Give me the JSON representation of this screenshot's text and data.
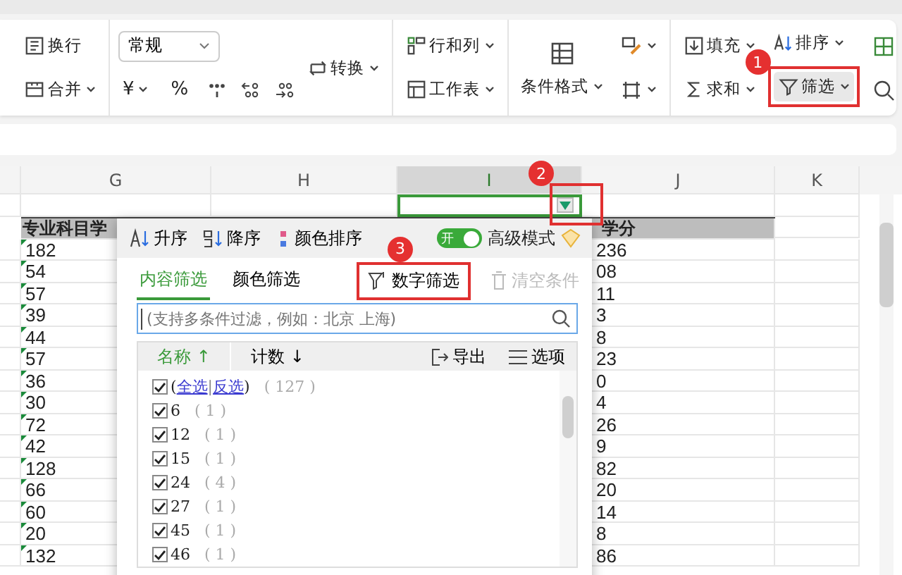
{
  "ribbon": {
    "groups": [
      {
        "columns": [
          [
            {
              "kind": "wrap",
              "label": "换行",
              "dropdown": false
            },
            {
              "kind": "merge",
              "label": "合并",
              "dropdown": true
            }
          ]
        ]
      },
      {
        "columns": [
          [
            {
              "kind": "select",
              "label": "常规",
              "dropdown": true
            },
            {
              "kind": "row",
              "items": [
                {
                  "kind": "text",
                  "label": "¥",
                  "dropdown": true
                },
                {
                  "kind": "text",
                  "label": "%",
                  "dropdown": false
                },
                {
                  "kind": "thousands"
                },
                {
                  "kind": "incdec"
                },
                {
                  "kind": "decdec"
                }
              ]
            }
          ],
          [
            {
              "kind": "convert",
              "label": "转换",
              "dropdown": true
            }
          ]
        ]
      },
      {
        "columns": [
          [
            {
              "kind": "rowcol",
              "label": "行和列",
              "dropdown": true
            },
            {
              "kind": "sheet",
              "label": "工作表",
              "dropdown": true
            }
          ]
        ]
      },
      {
        "columns": [
          [
            {
              "kind": "condformat",
              "label": "条件格式",
              "dropdown": true
            }
          ],
          [
            {
              "kind": "brush",
              "dropdown": true
            },
            {
              "kind": "border",
              "dropdown": true
            }
          ]
        ]
      },
      {
        "columns": [
          [
            {
              "kind": "fill",
              "label": "填充",
              "dropdown": true
            },
            {
              "kind": "sum",
              "label": "求和",
              "dropdown": true
            }
          ],
          [
            {
              "kind": "sort",
              "label": "排序",
              "dropdown": true
            },
            {
              "kind": "filter",
              "label": "筛选",
              "dropdown": true,
              "selected": true,
              "callout": "1"
            }
          ],
          [
            {
              "kind": "grid"
            },
            {
              "kind": "search"
            }
          ]
        ]
      }
    ]
  },
  "sheet": {
    "columns": [
      {
        "label": "G",
        "selected": false
      },
      {
        "label": "H",
        "selected": false
      },
      {
        "label": "I",
        "selected": true
      },
      {
        "label": "J",
        "selected": false
      },
      {
        "label": "K",
        "selected": false
      }
    ],
    "filter_button": {
      "callout": "2"
    },
    "header": {
      "g": "专业科目学",
      "j": "学分"
    },
    "rows": [
      {
        "g": "182",
        "j": "236"
      },
      {
        "g": "54",
        "j": "08"
      },
      {
        "g": "57",
        "j": "11"
      },
      {
        "g": "39",
        "j": "3"
      },
      {
        "g": "44",
        "j": "8"
      },
      {
        "g": "57",
        "j": "23"
      },
      {
        "g": "36",
        "j": "0"
      },
      {
        "g": "30",
        "j": "4"
      },
      {
        "g": "72",
        "j": "26"
      },
      {
        "g": "42",
        "j": "9"
      },
      {
        "g": "128",
        "j": "82"
      },
      {
        "g": "66",
        "j": "20"
      },
      {
        "g": "60",
        "j": "14"
      },
      {
        "g": "20",
        "j": "8"
      },
      {
        "g": "132",
        "j": "86"
      }
    ]
  },
  "filter_popup": {
    "sort_buttons": [
      {
        "kind": "asc",
        "label": "升序"
      },
      {
        "kind": "desc",
        "label": "降序"
      },
      {
        "kind": "color",
        "label": "颜色排序"
      }
    ],
    "advanced": {
      "switch_label": "开",
      "on": true,
      "label": "高级模式"
    },
    "tabs": [
      {
        "label": "内容筛选",
        "selected": true
      },
      {
        "label": "颜色筛选",
        "selected": false
      }
    ],
    "number_filter": {
      "label": "数字筛选",
      "callout": "3"
    },
    "clear": {
      "label": "清空条件",
      "disabled": true
    },
    "search": {
      "placeholder": "(支持多条件过滤，例如：北京 上海)"
    },
    "list_header": {
      "name": "名称",
      "name_arrow": "↑",
      "count": "计数",
      "count_arrow": "↓",
      "export": "导出",
      "options": "选项"
    },
    "all_item": {
      "checked": true,
      "open": "(",
      "select_all": "全选",
      "separator": "|",
      "invert": "反选",
      "close": ")",
      "count": "( 127 )"
    },
    "items": [
      {
        "value": "6",
        "count": "( 1 )",
        "checked": true
      },
      {
        "value": "12",
        "count": "( 1 )",
        "checked": true
      },
      {
        "value": "15",
        "count": "( 1 )",
        "checked": true
      },
      {
        "value": "24",
        "count": "( 4 )",
        "checked": true
      },
      {
        "value": "27",
        "count": "( 1 )",
        "checked": true
      },
      {
        "value": "45",
        "count": "( 1 )",
        "checked": true
      },
      {
        "value": "46",
        "count": "( 1 )",
        "checked": true
      }
    ]
  }
}
